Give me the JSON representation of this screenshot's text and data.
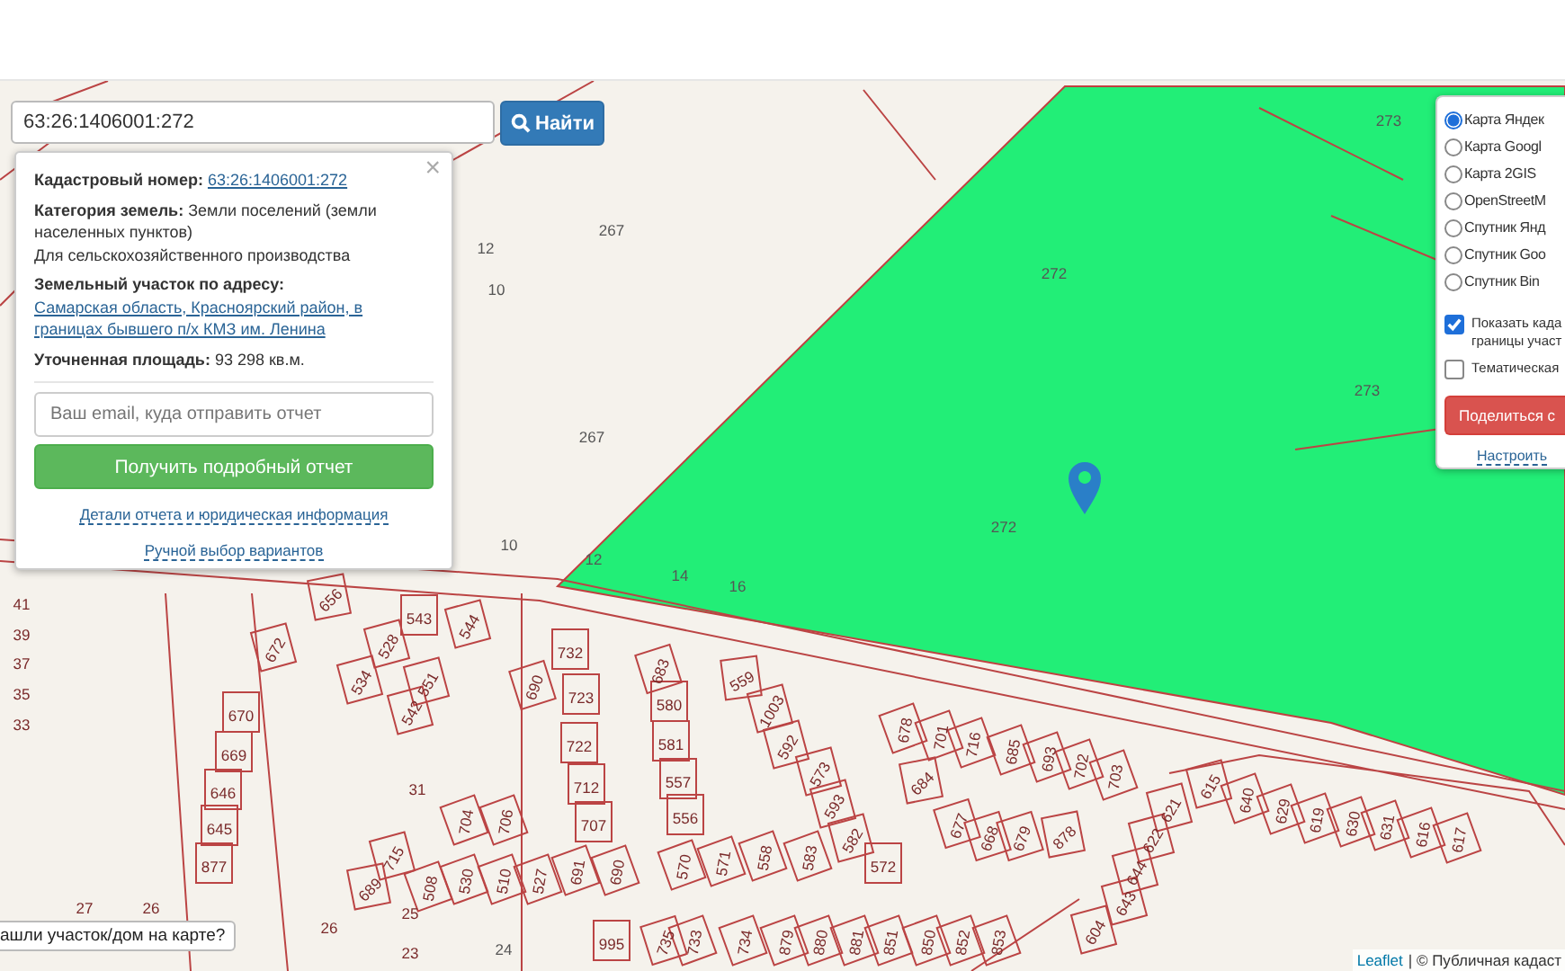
{
  "search": {
    "value": "63:26:1406001:272",
    "button": "Найти"
  },
  "popup": {
    "close": "×",
    "cadastral": {
      "label": "Кадастровый номер:",
      "link": "63:26:1406001:272"
    },
    "category": {
      "label": "Категория земель:",
      "value": "Земли поселений (земли населенных пунктов)",
      "use": "Для сельскохозяйственного производства"
    },
    "address": {
      "label": "Земельный участок по адресу:",
      "link": "Самарская область, Красноярский район, в границах бывшего п/х КМЗ им. Ленина"
    },
    "area": {
      "label": "Уточненная площадь:",
      "value": "93 298 кв.м."
    },
    "email": {
      "placeholder": "Ваш email, куда отправить отчет"
    },
    "button": "Получить подробный отчет",
    "links": [
      "Детали отчета и юридическая информация",
      "Ручной выбор вариантов"
    ]
  },
  "layers": [
    {
      "label": "Карта Яндек",
      "selected": true
    },
    {
      "label": "Карта Googl",
      "selected": false
    },
    {
      "label": "Карта 2GIS",
      "selected": false
    },
    {
      "label": "OpenStreetM",
      "selected": false
    },
    {
      "label": "Спутник Янд",
      "selected": false
    },
    {
      "label": "Спутник Goo",
      "selected": false
    },
    {
      "label": "Спутник Bin",
      "selected": false
    }
  ],
  "options": [
    {
      "lines": [
        "Показать када",
        "границы участ"
      ],
      "checked": true
    },
    {
      "lines": [
        "Тематическая"
      ],
      "checked": false
    }
  ],
  "share_button": "Поделиться с",
  "settings_link": "Настроить",
  "parcel_labels": [
    "273",
    "267",
    "12",
    "10",
    "272",
    "273",
    "267",
    "272",
    "10",
    "12",
    "14",
    "16",
    "41",
    "39",
    "37",
    "35",
    "33",
    "656",
    "543",
    "544",
    "732",
    "683",
    "559",
    "672",
    "670",
    "669",
    "646",
    "645",
    "877",
    "528",
    "534",
    "551",
    "542",
    "690",
    "723",
    "580",
    "722",
    "581",
    "31",
    "712",
    "557",
    "707",
    "556",
    "1003",
    "592",
    "573",
    "593",
    "582",
    "572",
    "678",
    "701",
    "716",
    "685",
    "693",
    "702",
    "703",
    "684",
    "677",
    "668",
    "679",
    "878",
    "615",
    "640",
    "629",
    "619",
    "630",
    "631",
    "616",
    "617",
    "621",
    "622",
    "644",
    "643",
    "604",
    "704",
    "706",
    "691",
    "690",
    "530",
    "510",
    "527",
    "570",
    "571",
    "558",
    "583",
    "689",
    "715",
    "508",
    "995",
    "735",
    "733",
    "734",
    "879",
    "880",
    "881",
    "851",
    "850",
    "852",
    "853",
    "27",
    "26",
    "26",
    "25",
    "23",
    "24"
  ],
  "bottom_tab": "ашли участок/дом на карте?",
  "attribution": {
    "link": "Leaflet",
    "text": "| © Публичная кадаст"
  }
}
